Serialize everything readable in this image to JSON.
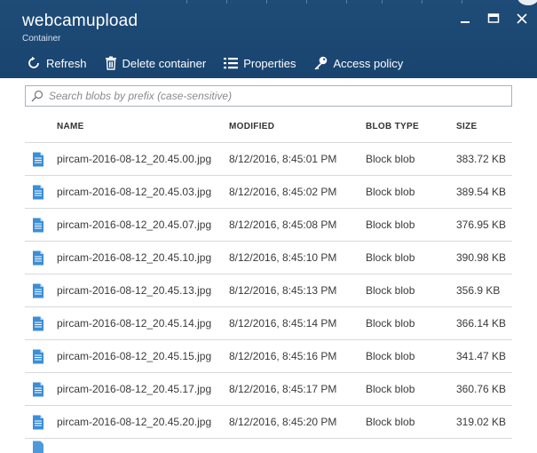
{
  "header": {
    "title": "webcamupload",
    "subtitle": "Container"
  },
  "toolbar": {
    "refresh": "Refresh",
    "delete": "Delete container",
    "properties": "Properties",
    "access": "Access policy"
  },
  "search": {
    "placeholder": "Search blobs by prefix (case-sensitive)"
  },
  "table": {
    "columns": [
      "NAME",
      "MODIFIED",
      "BLOB TYPE",
      "SIZE"
    ],
    "rows": [
      {
        "name": "pircam-2016-08-12_20.45.00.jpg",
        "modified": "8/12/2016, 8:45:01 PM",
        "type": "Block blob",
        "size": "383.72 KB"
      },
      {
        "name": "pircam-2016-08-12_20.45.03.jpg",
        "modified": "8/12/2016, 8:45:02 PM",
        "type": "Block blob",
        "size": "389.54 KB"
      },
      {
        "name": "pircam-2016-08-12_20.45.07.jpg",
        "modified": "8/12/2016, 8:45:08 PM",
        "type": "Block blob",
        "size": "376.95 KB"
      },
      {
        "name": "pircam-2016-08-12_20.45.10.jpg",
        "modified": "8/12/2016, 8:45:10 PM",
        "type": "Block blob",
        "size": "390.98 KB"
      },
      {
        "name": "pircam-2016-08-12_20.45.13.jpg",
        "modified": "8/12/2016, 8:45:13 PM",
        "type": "Block blob",
        "size": "356.9 KB"
      },
      {
        "name": "pircam-2016-08-12_20.45.14.jpg",
        "modified": "8/12/2016, 8:45:14 PM",
        "type": "Block blob",
        "size": "366.14 KB"
      },
      {
        "name": "pircam-2016-08-12_20.45.15.jpg",
        "modified": "8/12/2016, 8:45:16 PM",
        "type": "Block blob",
        "size": "341.47 KB"
      },
      {
        "name": "pircam-2016-08-12_20.45.17.jpg",
        "modified": "8/12/2016, 8:45:17 PM",
        "type": "Block blob",
        "size": "360.76 KB"
      },
      {
        "name": "pircam-2016-08-12_20.45.20.jpg",
        "modified": "8/12/2016, 8:45:20 PM",
        "type": "Block blob",
        "size": "319.02 KB"
      }
    ]
  },
  "colors": {
    "header_bg": "#1f4e79",
    "icon_blue": "#3b8ed8"
  }
}
